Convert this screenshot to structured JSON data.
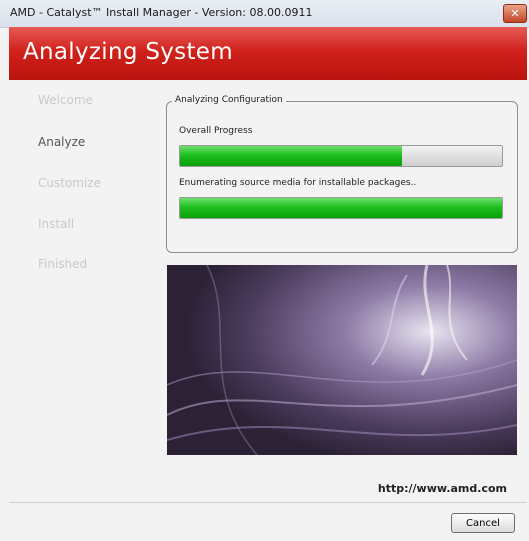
{
  "window": {
    "title": "AMD - Catalyst™ Install Manager - Version: 08.00.0911",
    "close_icon": "close-icon"
  },
  "banner": {
    "heading": "Analyzing System"
  },
  "sidebar": {
    "steps": [
      {
        "label": "Welcome",
        "active": false
      },
      {
        "label": "Analyze",
        "active": true
      },
      {
        "label": "Customize",
        "active": false
      },
      {
        "label": "Install",
        "active": false
      },
      {
        "label": "Finished",
        "active": false
      }
    ]
  },
  "config": {
    "legend": "Analyzing Configuration",
    "overall_label": "Overall Progress",
    "overall_progress": 0.69,
    "status_text": "Enumerating source media for installable packages..",
    "task_progress": 1.0
  },
  "footer": {
    "url": "http://www.amd.com",
    "cancel_label": "Cancel"
  },
  "colors": {
    "banner_red": "#d1221c",
    "progress_green": "#1fbf1f"
  }
}
